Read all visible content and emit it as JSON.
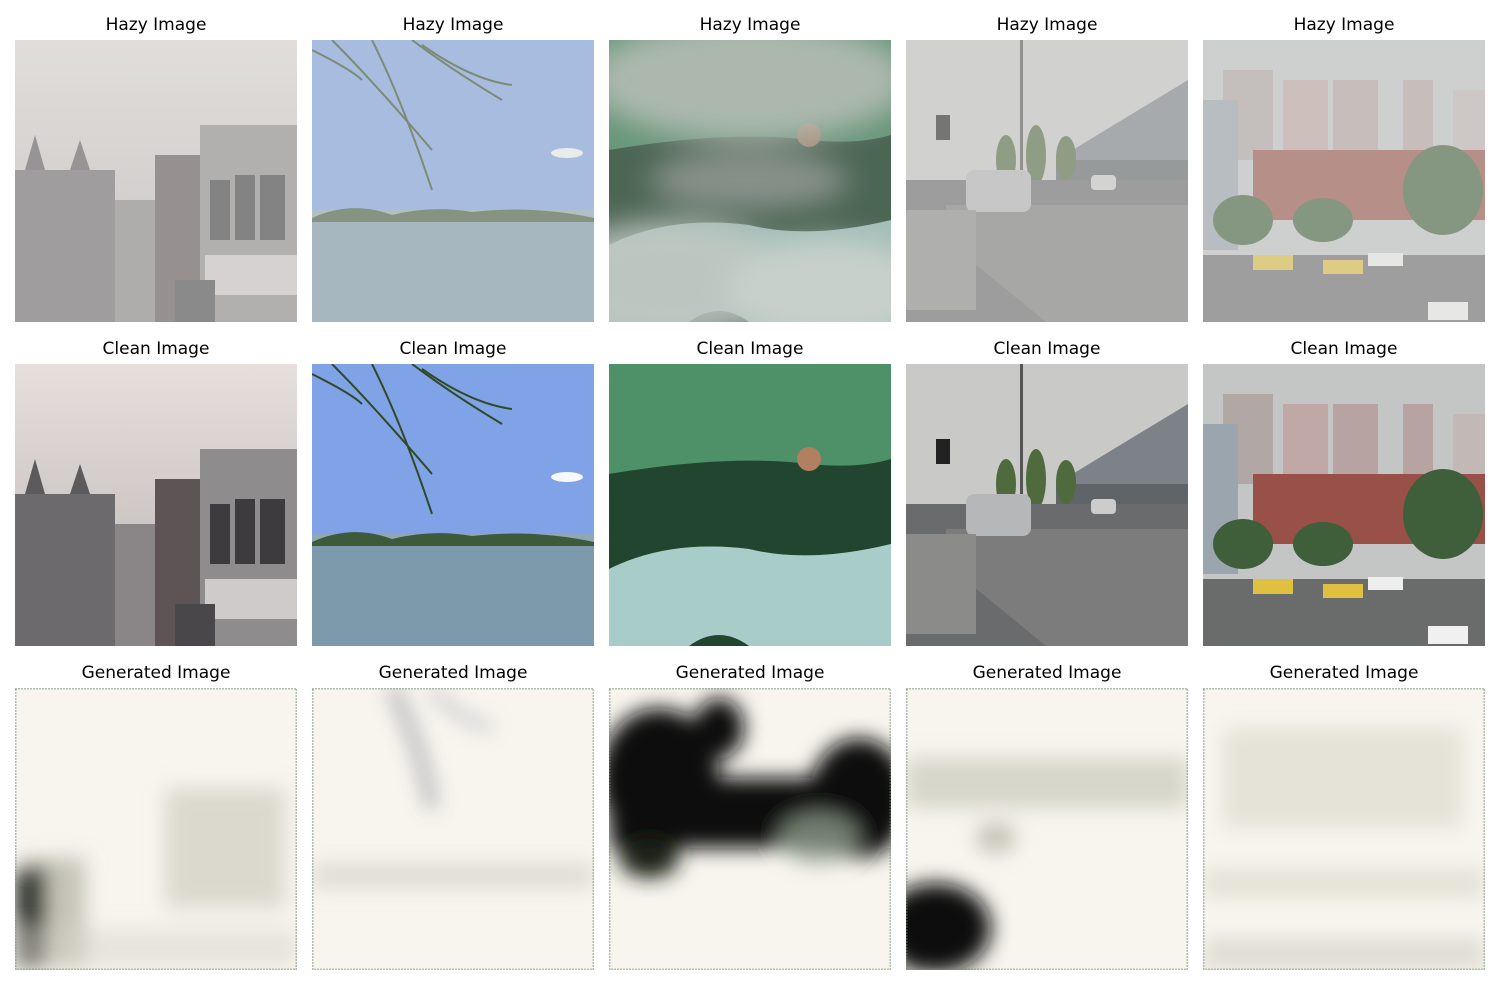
{
  "figure": {
    "rows": [
      {
        "row_label": "Hazy Image",
        "panels": [
          {
            "title": "Hazy Image",
            "scene": "city-buildings",
            "variant": "hazy"
          },
          {
            "title": "Hazy Image",
            "scene": "lake-willow",
            "variant": "hazy"
          },
          {
            "title": "Hazy Image",
            "scene": "aerial-forest",
            "variant": "hazy"
          },
          {
            "title": "Hazy Image",
            "scene": "street-station",
            "variant": "hazy"
          },
          {
            "title": "Hazy Image",
            "scene": "highrise-road",
            "variant": "hazy"
          }
        ]
      },
      {
        "row_label": "Clean Image",
        "panels": [
          {
            "title": "Clean Image",
            "scene": "city-buildings",
            "variant": "clean"
          },
          {
            "title": "Clean Image",
            "scene": "lake-willow",
            "variant": "clean"
          },
          {
            "title": "Clean Image",
            "scene": "aerial-forest",
            "variant": "clean"
          },
          {
            "title": "Clean Image",
            "scene": "street-station",
            "variant": "clean"
          },
          {
            "title": "Clean Image",
            "scene": "highrise-road",
            "variant": "clean"
          }
        ]
      },
      {
        "row_label": "Generated Image",
        "panels": [
          {
            "title": "Generated Image",
            "scene": "city-buildings",
            "variant": "generated"
          },
          {
            "title": "Generated Image",
            "scene": "lake-willow",
            "variant": "generated"
          },
          {
            "title": "Generated Image",
            "scene": "aerial-forest",
            "variant": "generated"
          },
          {
            "title": "Generated Image",
            "scene": "street-station",
            "variant": "generated"
          },
          {
            "title": "Generated Image",
            "scene": "highrise-road",
            "variant": "generated"
          }
        ]
      }
    ]
  },
  "colors": {
    "background": "#ffffff",
    "title_text": "#000000",
    "generated_base": "#f7f5ee",
    "generated_dark": "#0c0f0a"
  }
}
